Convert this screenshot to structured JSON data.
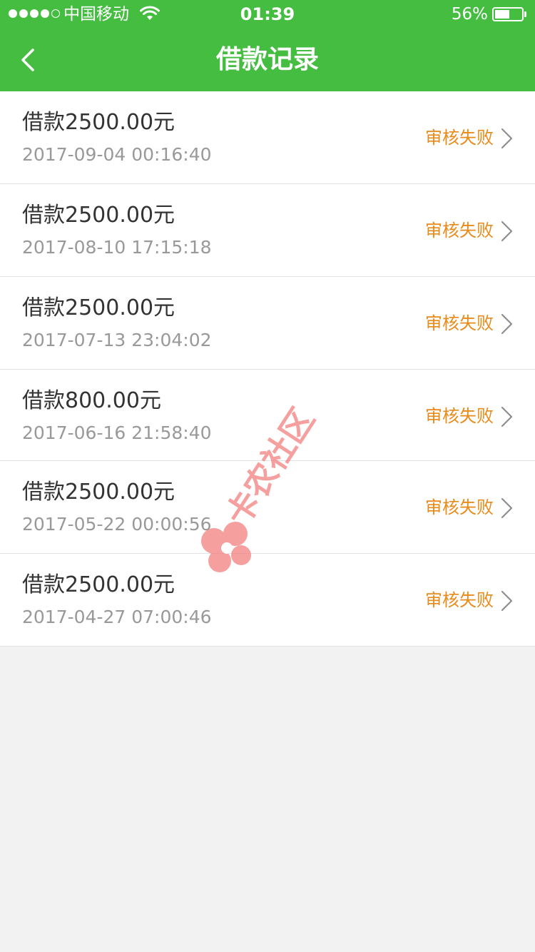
{
  "status_bar": {
    "carrier": "中国移动",
    "time": "01:39",
    "battery_percent": "56%",
    "battery_level": 0.56,
    "signal_bars": 4,
    "signal_total": 5
  },
  "nav": {
    "back_icon": "chevron-left-icon",
    "title": "借款记录"
  },
  "records": [
    {
      "amount": "借款2500.00元",
      "date": "2017-09-04 00:16:40",
      "status": "审核失败"
    },
    {
      "amount": "借款2500.00元",
      "date": "2017-08-10 17:15:18",
      "status": "审核失败"
    },
    {
      "amount": "借款2500.00元",
      "date": "2017-07-13 23:04:02",
      "status": "审核失败"
    },
    {
      "amount": "借款800.00元",
      "date": "2017-06-16 21:58:40",
      "status": "审核失败"
    },
    {
      "amount": "借款2500.00元",
      "date": "2017-05-22 00:00:56",
      "status": "审核失败"
    },
    {
      "amount": "借款2500.00元",
      "date": "2017-04-27 07:00:46",
      "status": "审核失败"
    }
  ],
  "watermark": "卡农社区",
  "colors": {
    "header": "#44bd40",
    "status_failed": "#e88b1a",
    "watermark": "#f47f7f",
    "background": "#f2f2f2"
  }
}
